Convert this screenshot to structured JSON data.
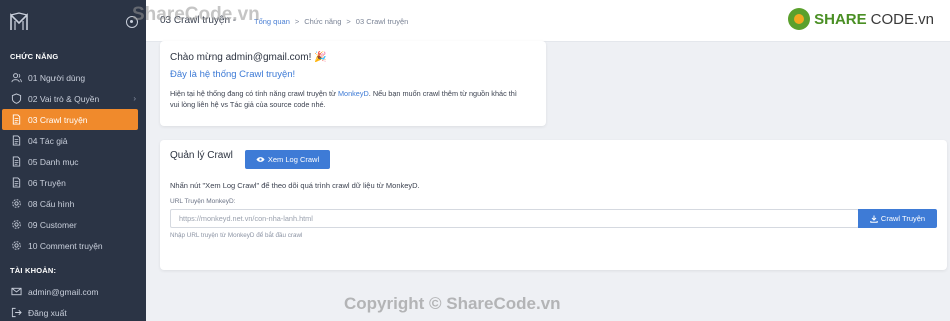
{
  "sidebar": {
    "section_features": "CHỨC NĂNG",
    "items": [
      {
        "label": "01 Người dùng",
        "icon": "users-icon"
      },
      {
        "label": "02 Vai trò & Quyền",
        "icon": "shield-icon",
        "chevron": "›"
      },
      {
        "label": "03 Crawl truyện",
        "icon": "document-icon",
        "active": true
      },
      {
        "label": "04 Tác giả",
        "icon": "document-icon"
      },
      {
        "label": "05 Danh mục",
        "icon": "document-icon"
      },
      {
        "label": "06 Truyện",
        "icon": "document-icon"
      },
      {
        "label": "08 Cấu hình",
        "icon": "gear-icon"
      },
      {
        "label": "09 Customer",
        "icon": "gear-icon"
      },
      {
        "label": "10 Comment truyện",
        "icon": "gear-icon"
      }
    ],
    "section_account": "TÀI KHOẢN:",
    "account_items": [
      {
        "label": "admin@gmail.com",
        "icon": "mail-icon"
      },
      {
        "label": "Đăng xuất",
        "icon": "logout-icon"
      }
    ]
  },
  "header": {
    "title": "03 Crawl truyện -",
    "breadcrumb": [
      "Tổng quan",
      ">",
      "Chức năng",
      ">",
      "03 Crawl truyện"
    ]
  },
  "watermark": {
    "top": "ShareCode.vn",
    "bottom": "Copyright © ShareCode.vn",
    "logo_main": "SHARE",
    "logo_suffix": "CODE.vn"
  },
  "welcome_card": {
    "greeting": "Chào mừng admin@gmail.com! 🎉",
    "subtitle": "Đây là hệ thống Crawl truyện!",
    "desc_prefix": "Hiện tại hệ thống đang có tính năng crawl truyện từ ",
    "desc_link": "MonkeyD",
    "desc_suffix": ". Nếu bạn muốn crawl thêm từ nguồn khác thì vui lòng liên hệ vs Tác giả của source code nhé."
  },
  "crawl_card": {
    "title": "Quản lý Crawl",
    "view_log_label": "Xem Log Crawl",
    "note": "Nhấn nút \"Xem Log Crawl\" để theo dõi quá trình crawl dữ liệu từ MonkeyD.",
    "url_label": "URL Truyện MonkeyD:",
    "url_placeholder": "https://monkeyd.net.vn/con-nha-lanh.html",
    "crawl_button_label": "Crawl Truyện",
    "hint": "Nhập URL truyện từ MonkeyD để bắt đầu crawl"
  },
  "colors": {
    "sidebar_bg": "#2b3445",
    "accent": "#f08a2c",
    "primary": "#3e7bd6"
  }
}
